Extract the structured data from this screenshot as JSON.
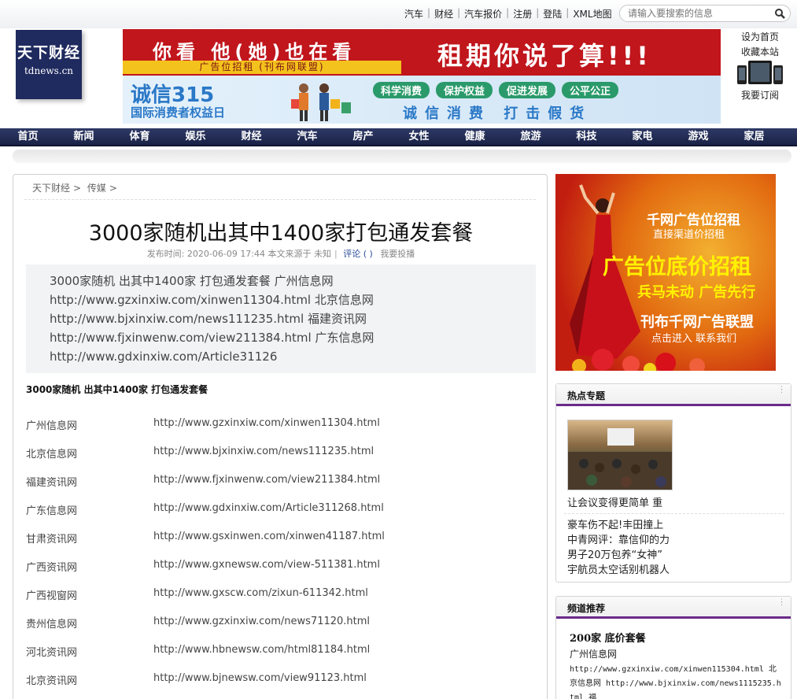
{
  "toplinks": [
    "汽车",
    "财经",
    "汽车报价",
    "注册",
    "登陆",
    "XML地图"
  ],
  "search": {
    "placeholder": "请输入要搜索的信息"
  },
  "logo": {
    "name": "天下财经",
    "domain": "tdnews.cn"
  },
  "header_ad1": {
    "left": "你看  他(她)也在看",
    "right": "租期你说了算!!!",
    "strip": "广告位招租  (刊布网联盟)"
  },
  "header_ad2": {
    "big": "诚信315",
    "sub": "国际消费者权益日",
    "pills": [
      "科学消费",
      "保护权益",
      "促进发展",
      "公平公正"
    ],
    "slogan": "诚信消费 打击假货"
  },
  "side_links": {
    "home": "设为首页",
    "fav": "收藏本站",
    "subscribe": "我要订阅"
  },
  "nav": [
    "首页",
    "新闻",
    "体育",
    "娱乐",
    "财经",
    "汽车",
    "房产",
    "女性",
    "健康",
    "旅游",
    "科技",
    "家电",
    "游戏",
    "家居"
  ],
  "breadcrumb": [
    "天下财经",
    "传媒"
  ],
  "article": {
    "title": "3000家随机出其中1400家打包通发套餐",
    "meta_prefix": "发布时间: 2020-06-09 17:44 本文来源于 未知",
    "comment": "评论 ( )",
    "submit": "我要投播",
    "summary": [
      "3000家随机 出其中1400家 打包通发套餐 广州信息网",
      "http://www.gzxinxiw.com/xinwen11304.html 北京信息网",
      "http://www.bjxinxiw.com/news111235.html 福建资讯网",
      "http://www.fjxinwenw.com/view211384.html 广东信息网",
      "http://www.gdxinxiw.com/Article31126"
    ],
    "bold_line": "3000家随机 出其中1400家 打包通发套餐",
    "rows": [
      {
        "name": "广州信息网",
        "url": "http://www.gzxinxiw.com/xinwen11304.html"
      },
      {
        "name": "北京信息网",
        "url": "http://www.bjxinxiw.com/news111235.html"
      },
      {
        "name": "福建资讯网",
        "url": "http://www.fjxinwenw.com/view211384.html"
      },
      {
        "name": "广东信息网",
        "url": "http://www.gdxinxiw.com/Article311268.html"
      },
      {
        "name": "甘肃资讯网",
        "url": "http://www.gsxinwen.com/xinwen41187.html"
      },
      {
        "name": "广西资讯网",
        "url": "http://www.gxnewsw.com/view-511381.html"
      },
      {
        "name": "广西视窗网",
        "url": "http://www.gxscw.com/zixun-611342.html"
      },
      {
        "name": "贵州信息网",
        "url": "http://www.gzxinxiw.com/news71120.html"
      },
      {
        "name": "河北资讯网",
        "url": "http://www.hbnewsw.com/html81184.html"
      },
      {
        "name": "北京资讯网",
        "url": "http://www.bjnewsw.com/view91123.html"
      }
    ]
  },
  "right_ad": {
    "l1": "千网广告位招租",
    "l2": "直接渠道价招租",
    "l3": "广告位底价招租",
    "l4": "兵马未动 广告先行",
    "l5": "刊布千网广告联盟",
    "l6": "点击进入 联系我们"
  },
  "hot": {
    "heading": "热点专题",
    "caption": "让会议变得更简单 重",
    "list": [
      "豪车伤不起!丰田撞上",
      "中青网评：靠信仰的力",
      "男子20万包养“女神”",
      "宇航员太空话别机器人"
    ]
  },
  "channel": {
    "heading": "频道推荐",
    "title": "200家 底价套餐",
    "line1": "广州信息网",
    "line2": "http://www.gzxinxiw.com/xinwen115304.html 北京信息网 http://www.bjxinxiw.com/news1115235.html 福"
  }
}
